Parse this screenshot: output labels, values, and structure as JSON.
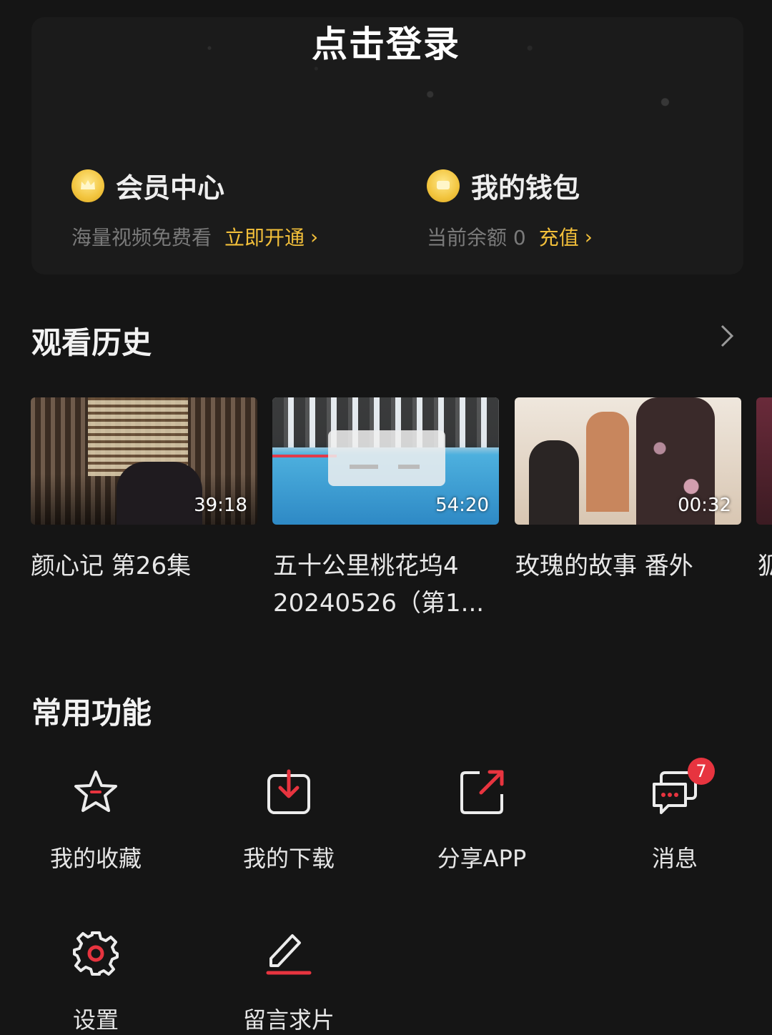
{
  "header": {
    "login_label": "点击登录",
    "member": {
      "title": "会员中心",
      "subtitle": "海量视频免费看",
      "cta": "立即开通"
    },
    "wallet": {
      "title": "我的钱包",
      "subtitle": "当前余额 0",
      "cta": "充值"
    }
  },
  "history": {
    "title": "观看历史",
    "items": [
      {
        "title": "颜心记 第26集",
        "duration": "39:18"
      },
      {
        "title": "五十公里桃花坞4 20240526（第1...",
        "duration": "54:20"
      },
      {
        "title": "玫瑰的故事 番外",
        "duration": "00:32"
      },
      {
        "title": "狐篇"
      }
    ]
  },
  "functions": {
    "title": "常用功能",
    "items": [
      {
        "label": "我的收藏",
        "icon": "star-icon"
      },
      {
        "label": "我的下载",
        "icon": "download-icon"
      },
      {
        "label": "分享APP",
        "icon": "share-icon"
      },
      {
        "label": "消息",
        "icon": "message-icon",
        "badge": "7"
      },
      {
        "label": "设置",
        "icon": "gear-icon"
      },
      {
        "label": "留言求片",
        "icon": "edit-icon"
      }
    ]
  },
  "colors": {
    "accent_gold": "#f2bf3a",
    "icon_red": "#e7343f",
    "background": "#151515"
  }
}
